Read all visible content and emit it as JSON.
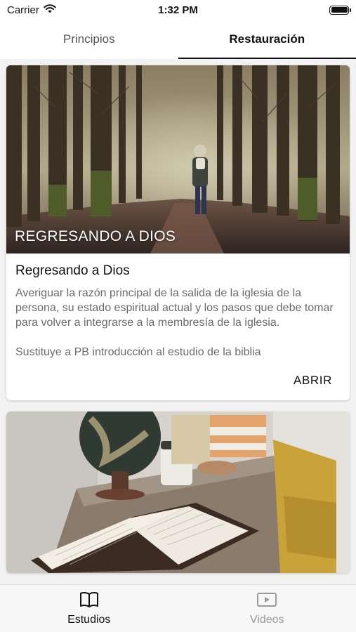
{
  "status_bar": {
    "carrier": "Carrier",
    "time": "1:32 PM"
  },
  "tabs": [
    {
      "label": "Principios",
      "active": false
    },
    {
      "label": "Restauración",
      "active": true
    }
  ],
  "cards": [
    {
      "image_title": "REGRESANDO A DIOS",
      "title": "Regresando a Dios",
      "description": "Averiguar la razón principal de la salida de la iglesia de la persona, su estado espiritual actual y los pasos que debe tomar para volver a integrarse a la membresía de la iglesia.",
      "note": "Sustituye a PB introducción al estudio de la biblia",
      "action_label": "ABRIR"
    }
  ],
  "bottom_nav": [
    {
      "label": "Estudios",
      "icon": "book-icon",
      "active": true
    },
    {
      "label": "Videos",
      "icon": "video-icon",
      "active": false
    }
  ],
  "colors": {
    "accent": "#111111",
    "inactive": "#9a9a9a",
    "description": "#6b6b6b"
  }
}
